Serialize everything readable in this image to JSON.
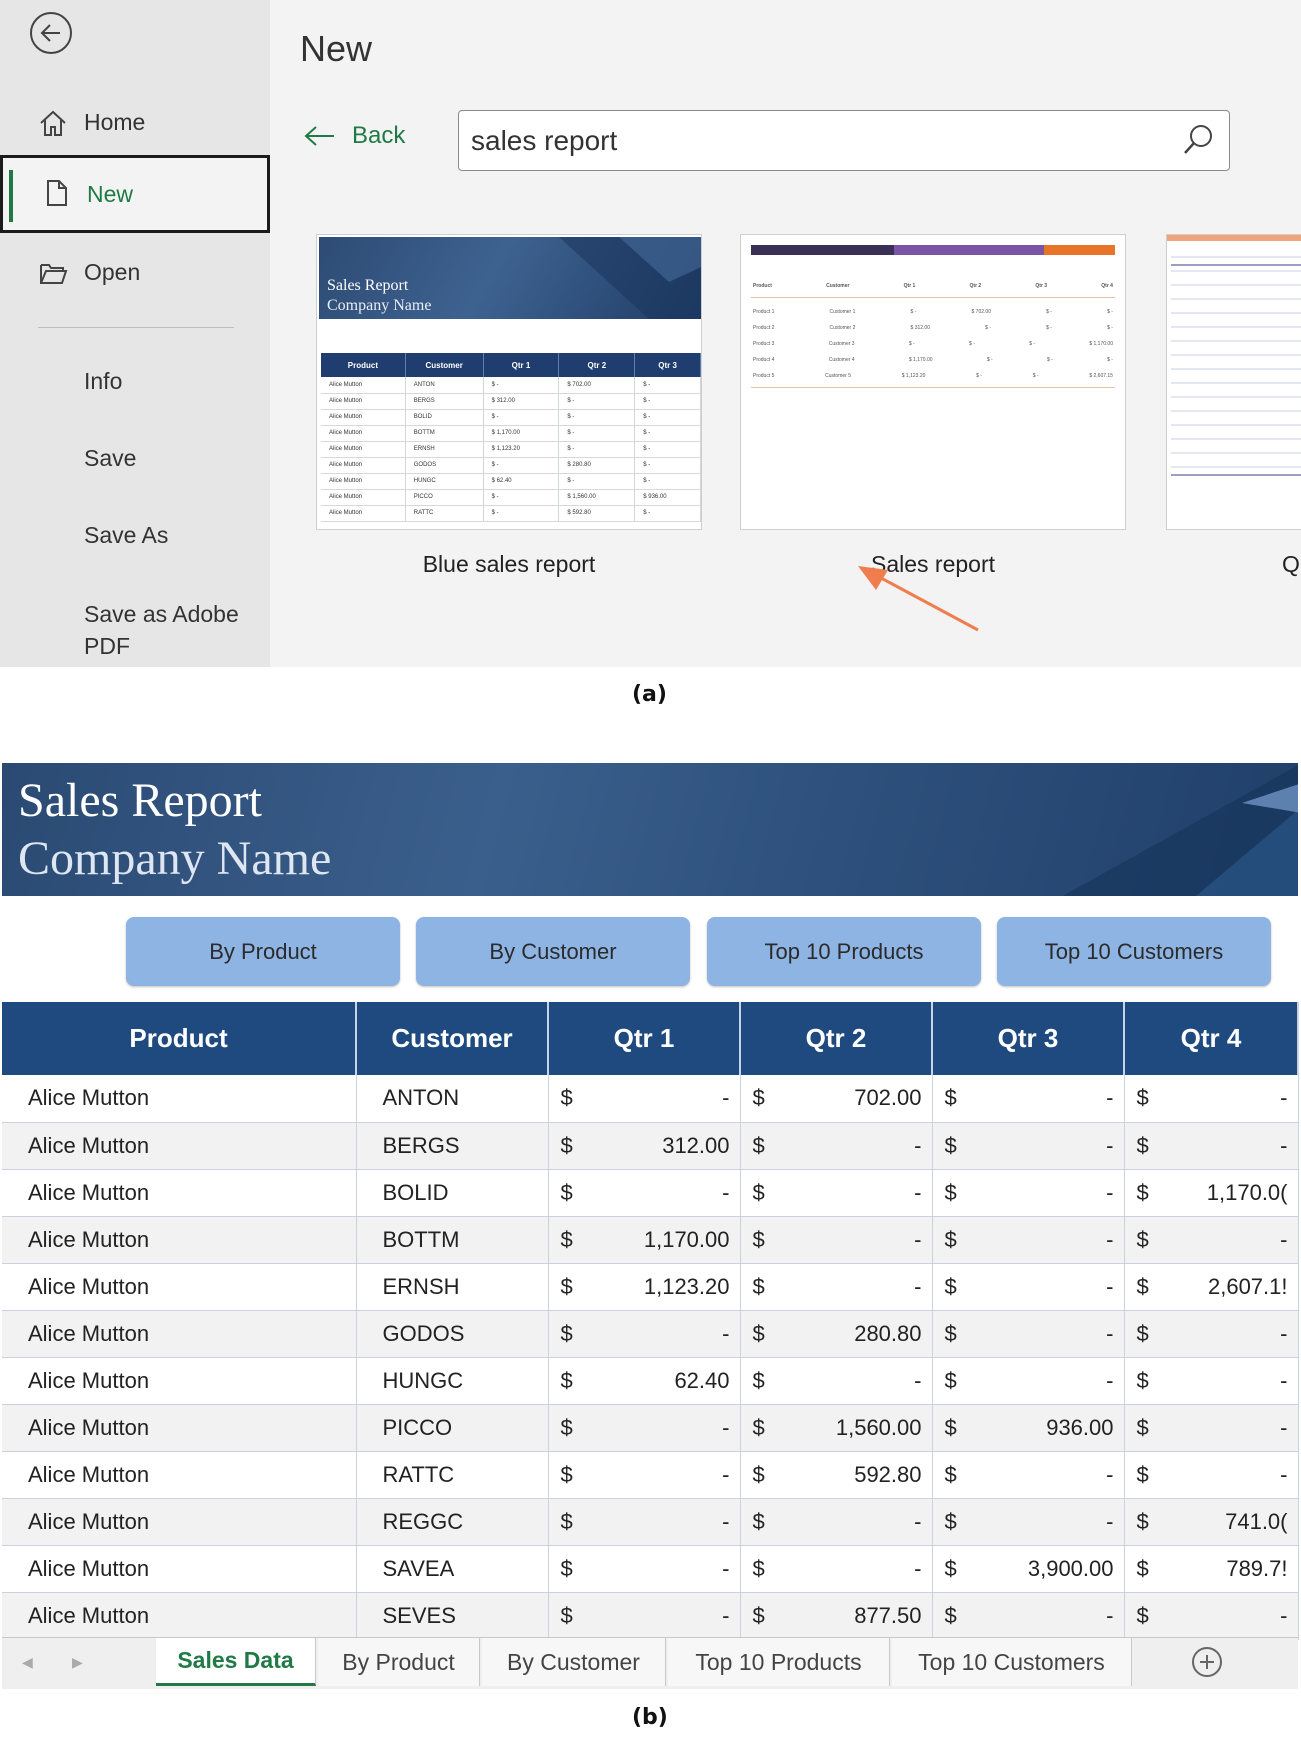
{
  "panel_a": {
    "caption": "(a)",
    "sidebar": {
      "items": [
        {
          "label": "Home",
          "icon": "home-icon"
        },
        {
          "label": "New",
          "icon": "new-document-icon"
        },
        {
          "label": "Open",
          "icon": "folder-open-icon"
        },
        {
          "label": "Info"
        },
        {
          "label": "Save"
        },
        {
          "label": "Save As"
        },
        {
          "label": "Save as Adobe PDF"
        }
      ]
    },
    "title": "New",
    "back_label": "Back",
    "search": {
      "value": "sales report"
    },
    "templates": [
      {
        "label": "Blue sales report",
        "thumb_title": "Sales Report",
        "thumb_subtitle": "Company Name",
        "thumb_headers": [
          "Product",
          "Customer",
          "Qtr 1",
          "Qtr 2",
          "Qtr 3"
        ],
        "thumb_rows": [
          [
            "Alice Mutton",
            "ANTON",
            "$ -",
            "$ 702.00",
            "$ -"
          ],
          [
            "Alice Mutton",
            "BERGS",
            "$ 312.00",
            "$ -",
            "$ -"
          ],
          [
            "Alice Mutton",
            "BOLID",
            "$ -",
            "$ -",
            "$ -"
          ],
          [
            "Alice Mutton",
            "BOTTM",
            "$ 1,170.00",
            "$ -",
            "$ -"
          ],
          [
            "Alice Mutton",
            "ERNSH",
            "$ 1,123.20",
            "$ -",
            "$ -"
          ],
          [
            "Alice Mutton",
            "GODOS",
            "$ -",
            "$ 280.80",
            "$ -"
          ],
          [
            "Alice Mutton",
            "HUNGC",
            "$ 62.40",
            "$ -",
            "$ -"
          ],
          [
            "Alice Mutton",
            "PICCO",
            "$ -",
            "$ 1,560.00",
            "$ 936.00"
          ],
          [
            "Alice Mutton",
            "RATTC",
            "$ -",
            "$ 592.80",
            "$ -"
          ]
        ]
      },
      {
        "label": "Sales report",
        "thumb_headers": [
          "Product",
          "Customer",
          "Qtr 1",
          "Qtr 2",
          "Qtr 3",
          "Qtr 4"
        ],
        "thumb_rows": [
          [
            "Product 1",
            "Customer 1",
            "$ -",
            "$ 702.00",
            "$ -",
            "$ -"
          ],
          [
            "Product 2",
            "Customer 2",
            "$ 312.00",
            "$ -",
            "$ -",
            "$ -"
          ],
          [
            "Product 3",
            "Customer 3",
            "$ -",
            "$ -",
            "$ -",
            "$ 1,170.00"
          ],
          [
            "Product 4",
            "Customer 4",
            "$ 1,170.00",
            "$ -",
            "$ -",
            "$ -"
          ],
          [
            "Product 5",
            "Customer 5",
            "$ 1,123.20",
            "$ -",
            "$ -",
            "$ 2,607.15"
          ]
        ]
      },
      {
        "label": "Quar"
      }
    ]
  },
  "panel_b": {
    "caption": "(b)",
    "banner_title": "Sales Report",
    "banner_subtitle": "Company Name",
    "buttons": [
      "By Product",
      "By Customer",
      "Top 10 Products",
      "Top 10 Customers"
    ],
    "headers": [
      "Product",
      "Customer",
      "Qtr 1",
      "Qtr 2",
      "Qtr 3",
      "Qtr 4"
    ],
    "rows": [
      {
        "product": "Alice Mutton",
        "customer": "ANTON",
        "q1": "-",
        "q2": "702.00",
        "q3": "-",
        "q4": "-"
      },
      {
        "product": "Alice Mutton",
        "customer": "BERGS",
        "q1": "312.00",
        "q2": "-",
        "q3": "-",
        "q4": "-"
      },
      {
        "product": "Alice Mutton",
        "customer": "BOLID",
        "q1": "-",
        "q2": "-",
        "q3": "-",
        "q4": "1,170.0("
      },
      {
        "product": "Alice Mutton",
        "customer": "BOTTM",
        "q1": "1,170.00",
        "q2": "-",
        "q3": "-",
        "q4": "-"
      },
      {
        "product": "Alice Mutton",
        "customer": "ERNSH",
        "q1": "1,123.20",
        "q2": "-",
        "q3": "-",
        "q4": "2,607.1!"
      },
      {
        "product": "Alice Mutton",
        "customer": "GODOS",
        "q1": "-",
        "q2": "280.80",
        "q3": "-",
        "q4": "-"
      },
      {
        "product": "Alice Mutton",
        "customer": "HUNGC",
        "q1": "62.40",
        "q2": "-",
        "q3": "-",
        "q4": "-"
      },
      {
        "product": "Alice Mutton",
        "customer": "PICCO",
        "q1": "-",
        "q2": "1,560.00",
        "q3": "936.00",
        "q4": "-"
      },
      {
        "product": "Alice Mutton",
        "customer": "RATTC",
        "q1": "-",
        "q2": "592.80",
        "q3": "-",
        "q4": "-"
      },
      {
        "product": "Alice Mutton",
        "customer": "REGGC",
        "q1": "-",
        "q2": "-",
        "q3": "-",
        "q4": "741.0("
      },
      {
        "product": "Alice Mutton",
        "customer": "SAVEA",
        "q1": "-",
        "q2": "-",
        "q3": "3,900.00",
        "q4": "789.7!"
      },
      {
        "product": "Alice Mutton",
        "customer": "SEVES",
        "q1": "-",
        "q2": "877.50",
        "q3": "-",
        "q4": "-"
      }
    ],
    "currency_symbol": "$",
    "sheet_tabs": [
      "Sales Data",
      "By Product",
      "By Customer",
      "Top 10 Products",
      "Top 10 Customers"
    ],
    "active_tab": "Sales Data"
  },
  "colors": {
    "accent_green": "#1f7a45",
    "header_blue": "#1f4a7f",
    "button_blue": "#8eb4e3",
    "arrow_orange": "#f07d4e"
  }
}
